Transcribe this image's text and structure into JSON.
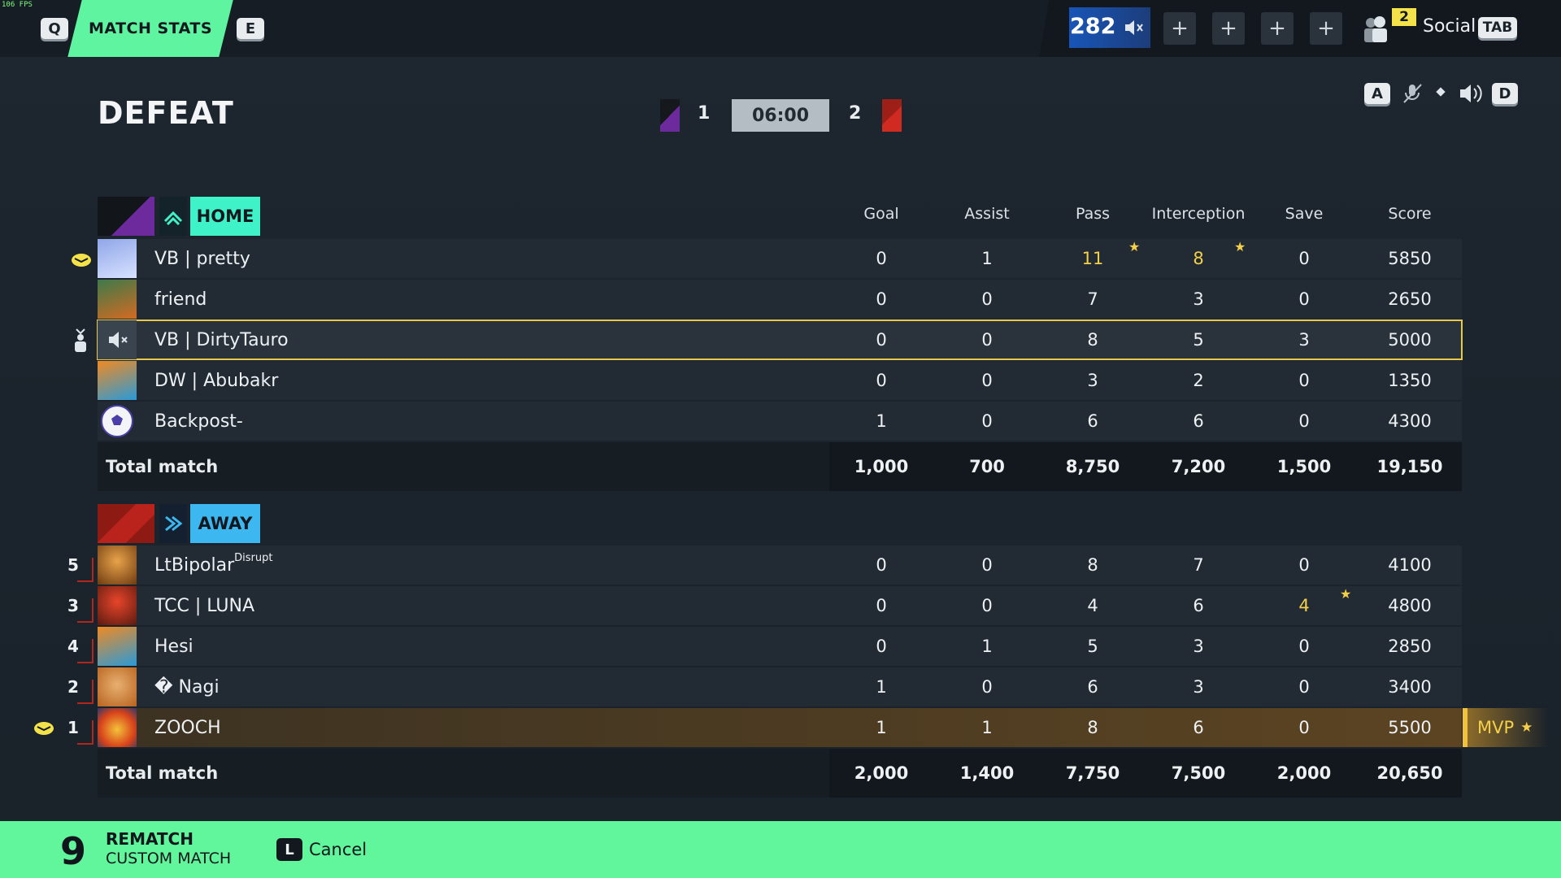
{
  "fps": "106 FPS",
  "nav": {
    "key_left": "Q",
    "active_tab": "MATCH STATS",
    "key_right": "E",
    "party_count": "282",
    "social_badge": "2",
    "social_label": "Social",
    "social_key": "TAB"
  },
  "audio_keys": {
    "left": "A",
    "right": "D"
  },
  "result": {
    "title": "DEFEAT",
    "home_score": "1",
    "away_score": "2",
    "time": "06:00"
  },
  "columns": [
    "Goal",
    "Assist",
    "Pass",
    "Interception",
    "Save",
    "Score"
  ],
  "home": {
    "label": "HOME",
    "players": [
      {
        "name": "VB | pretty",
        "goal": "0",
        "assist": "1",
        "pass": "11",
        "interception": "8",
        "save": "0",
        "score": "5850"
      },
      {
        "name": "friend",
        "goal": "0",
        "assist": "0",
        "pass": "7",
        "interception": "3",
        "save": "0",
        "score": "2650"
      },
      {
        "name": "VB | DirtyTauro",
        "goal": "0",
        "assist": "0",
        "pass": "8",
        "interception": "5",
        "save": "3",
        "score": "5000"
      },
      {
        "name": "DW | Abubakr",
        "goal": "0",
        "assist": "0",
        "pass": "3",
        "interception": "2",
        "save": "0",
        "score": "1350"
      },
      {
        "name": "Backpost-",
        "goal": "1",
        "assist": "0",
        "pass": "6",
        "interception": "6",
        "save": "0",
        "score": "4300"
      }
    ],
    "total": {
      "label": "Total match",
      "goal": "1,000",
      "assist": "700",
      "pass": "8,750",
      "interception": "7,200",
      "save": "1,500",
      "score": "19,150"
    }
  },
  "away": {
    "label": "AWAY",
    "players": [
      {
        "rank": "5",
        "name": "LtBipolar",
        "tag": "Disrupt",
        "goal": "0",
        "assist": "0",
        "pass": "8",
        "interception": "7",
        "save": "0",
        "score": "4100"
      },
      {
        "rank": "3",
        "name": "TCC | LUNA",
        "tag": "",
        "goal": "0",
        "assist": "0",
        "pass": "4",
        "interception": "6",
        "save": "4",
        "score": "4800"
      },
      {
        "rank": "4",
        "name": "Hesi",
        "tag": "",
        "goal": "0",
        "assist": "1",
        "pass": "5",
        "interception": "3",
        "save": "0",
        "score": "2850"
      },
      {
        "rank": "2",
        "name": "� Nagi",
        "tag": "",
        "goal": "1",
        "assist": "0",
        "pass": "6",
        "interception": "3",
        "save": "0",
        "score": "3400"
      },
      {
        "rank": "1",
        "name": "ZOOCH",
        "tag": "",
        "goal": "1",
        "assist": "1",
        "pass": "8",
        "interception": "6",
        "save": "0",
        "score": "5500"
      }
    ],
    "total": {
      "label": "Total match",
      "goal": "2,000",
      "assist": "1,400",
      "pass": "7,750",
      "interception": "7,500",
      "save": "2,000",
      "score": "20,650"
    }
  },
  "mvp_label": "MVP",
  "footer": {
    "countdown": "9",
    "rematch": "REMATCH",
    "mode": "CUSTOM MATCH",
    "cancel_key": "L",
    "cancel_label": "Cancel"
  },
  "colors": {
    "accent_green": "#5ef4a0",
    "home_accent": "#3ff2c8",
    "away_accent": "#3db7f0",
    "gold": "#f4d04a",
    "away_red": "#b2261e"
  }
}
